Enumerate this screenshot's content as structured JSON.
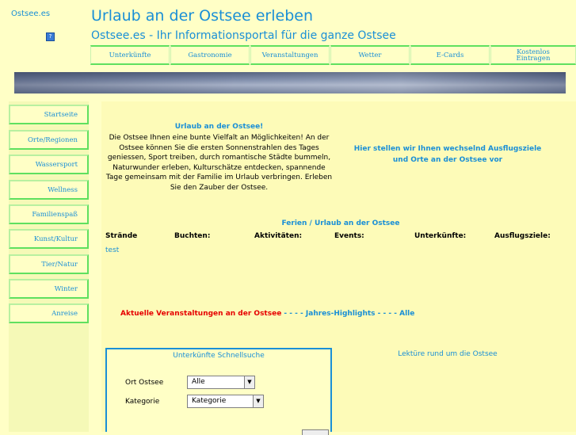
{
  "header": {
    "site_name": "Ostsee.es",
    "title": "Urlaub an der Ostsee erleben",
    "subtitle": "Ostsee.es - Ihr Informationsportal für die ganze Ostsee"
  },
  "top_nav": [
    "Unterkünfte",
    "Gastronomie",
    "Veranstaltungen",
    "Wetter",
    "E-Cards",
    "Kostenlos Eintragen"
  ],
  "sidebar": [
    "Startseite",
    "Orte/Regionen",
    "Wassersport",
    "Wellness",
    "Familienspaß",
    "Kunst/Kultur",
    "Tier/Natur",
    "Winter",
    "Anreise"
  ],
  "intro": {
    "title": "Urlaub an der Ostsee!",
    "text": "Die Ostsee Ihnen eine bunte Vielfalt an Möglichkeiten! An der Ostsee können Sie die ersten Sonnenstrahlen des Tages geniessen, Sport treiben, durch romantische Städte bummeln, Naturwunder erleben, Kulturschätze entdecken, spannende Tage gemeinsam mit der Familie im Urlaub verbringen. Erleben Sie den Zauber der Ostsee."
  },
  "excursions": {
    "text": "Hier stellen wir Ihnen wechselnd Ausflugsziele und Orte an der Ostsee vor"
  },
  "ferien": {
    "title": "Ferien / Urlaub an der Ostsee",
    "columns": [
      "Strände",
      "Buchten:",
      "Aktivitäten:",
      "Events:",
      "Unterkünfte:",
      "Ausflugsziele:"
    ],
    "first_cell": "test"
  },
  "events_line": {
    "part1": "Aktuelle Veranstaltungen an der Ostsee",
    "sep1": " - - - - ",
    "part2": "Jahres-Highlights",
    "sep2": " - - - - ",
    "part3": "Alle"
  },
  "quick_search": {
    "title": "Unterkünfte Schnellsuche",
    "ort_label": "Ort Ostsee",
    "ort_value": "Alle",
    "kategorie_label": "Kategorie",
    "kategorie_value": "Kategorie"
  },
  "lektuere": {
    "text": "Lektüre rund um die Ostsee"
  },
  "icons": {
    "flag": "flag-icon",
    "dropdown": "chevron-down-icon"
  },
  "colors": {
    "background": "#ffffc6",
    "accent_blue": "#1a8fd6",
    "nav_green": "#5fe05f",
    "highlight_red": "#e60000"
  }
}
